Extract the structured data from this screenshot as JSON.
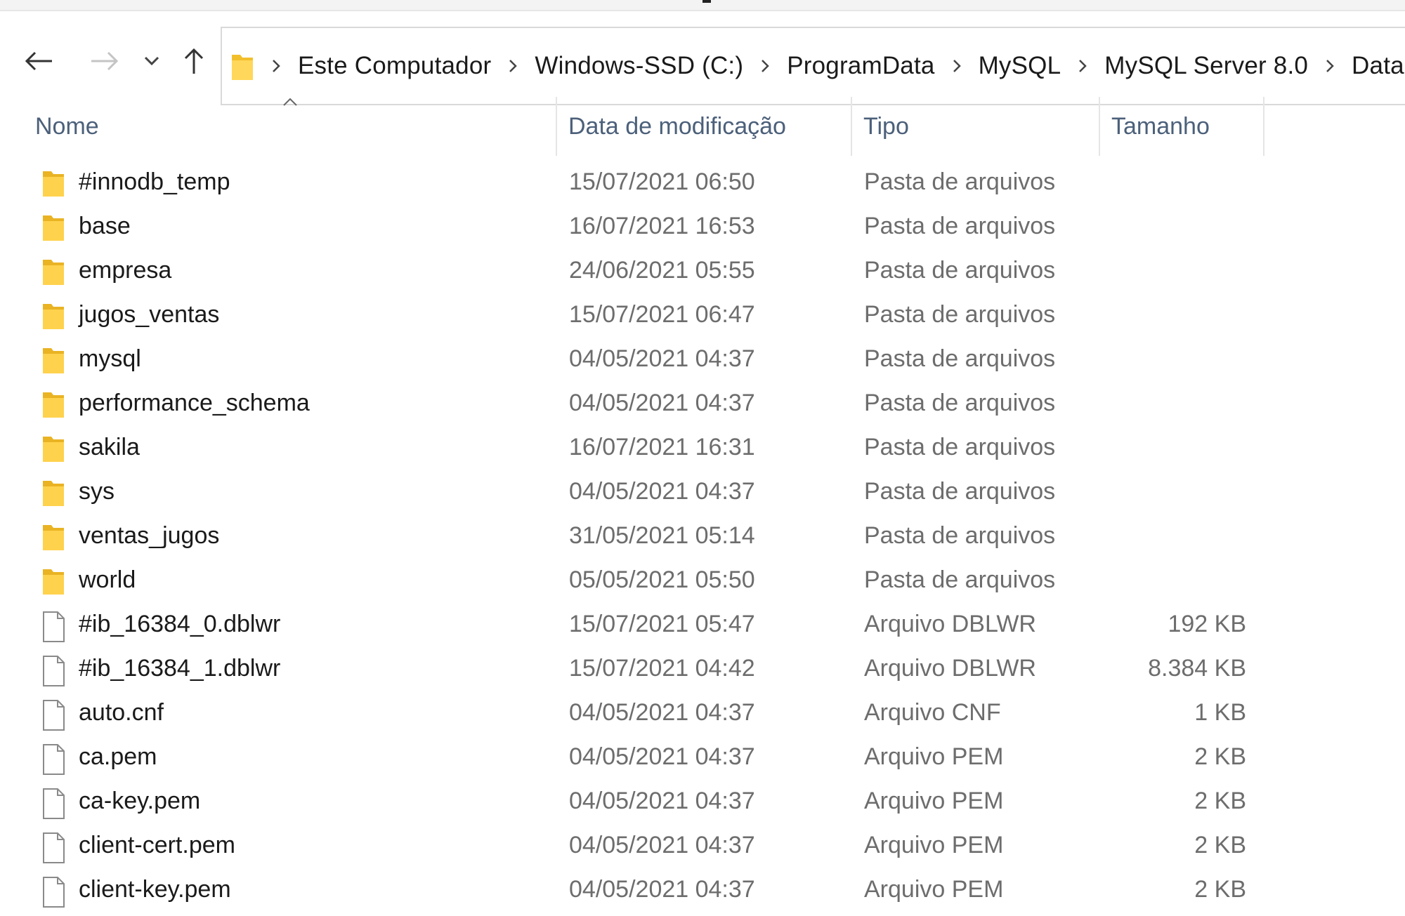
{
  "breadcrumbs": [
    "Este Computador",
    "Windows-SSD (C:)",
    "ProgramData",
    "MySQL",
    "MySQL Server 8.0",
    "Data"
  ],
  "columns": {
    "name": "Nome",
    "date": "Data de modificação",
    "type": "Tipo",
    "size": "Tamanho"
  },
  "colors": {
    "folder": "#f4c430",
    "header_text": "#4c607a",
    "secondary_text": "#6d6d6d"
  },
  "files": [
    {
      "icon": "folder-icon",
      "name": "#innodb_temp",
      "date": "15/07/2021 06:50",
      "type": "Pasta de arquivos",
      "size": ""
    },
    {
      "icon": "folder-icon",
      "name": "base",
      "date": "16/07/2021 16:53",
      "type": "Pasta de arquivos",
      "size": ""
    },
    {
      "icon": "folder-icon",
      "name": "empresa",
      "date": "24/06/2021 05:55",
      "type": "Pasta de arquivos",
      "size": ""
    },
    {
      "icon": "folder-icon",
      "name": "jugos_ventas",
      "date": "15/07/2021 06:47",
      "type": "Pasta de arquivos",
      "size": ""
    },
    {
      "icon": "folder-icon",
      "name": "mysql",
      "date": "04/05/2021 04:37",
      "type": "Pasta de arquivos",
      "size": ""
    },
    {
      "icon": "folder-icon",
      "name": "performance_schema",
      "date": "04/05/2021 04:37",
      "type": "Pasta de arquivos",
      "size": ""
    },
    {
      "icon": "folder-icon",
      "name": "sakila",
      "date": "16/07/2021 16:31",
      "type": "Pasta de arquivos",
      "size": ""
    },
    {
      "icon": "folder-icon",
      "name": "sys",
      "date": "04/05/2021 04:37",
      "type": "Pasta de arquivos",
      "size": ""
    },
    {
      "icon": "folder-icon",
      "name": "ventas_jugos",
      "date": "31/05/2021 05:14",
      "type": "Pasta de arquivos",
      "size": ""
    },
    {
      "icon": "folder-icon",
      "name": "world",
      "date": "05/05/2021 05:50",
      "type": "Pasta de arquivos",
      "size": ""
    },
    {
      "icon": "file-icon",
      "name": "#ib_16384_0.dblwr",
      "date": "15/07/2021 05:47",
      "type": "Arquivo DBLWR",
      "size": "192 KB"
    },
    {
      "icon": "file-icon",
      "name": "#ib_16384_1.dblwr",
      "date": "15/07/2021 04:42",
      "type": "Arquivo DBLWR",
      "size": "8.384 KB"
    },
    {
      "icon": "file-icon",
      "name": "auto.cnf",
      "date": "04/05/2021 04:37",
      "type": "Arquivo CNF",
      "size": "1 KB"
    },
    {
      "icon": "file-icon",
      "name": "ca.pem",
      "date": "04/05/2021 04:37",
      "type": "Arquivo PEM",
      "size": "2 KB"
    },
    {
      "icon": "file-icon",
      "name": "ca-key.pem",
      "date": "04/05/2021 04:37",
      "type": "Arquivo PEM",
      "size": "2 KB"
    },
    {
      "icon": "file-icon",
      "name": "client-cert.pem",
      "date": "04/05/2021 04:37",
      "type": "Arquivo PEM",
      "size": "2 KB"
    },
    {
      "icon": "file-icon",
      "name": "client-key.pem",
      "date": "04/05/2021 04:37",
      "type": "Arquivo PEM",
      "size": "2 KB"
    }
  ]
}
